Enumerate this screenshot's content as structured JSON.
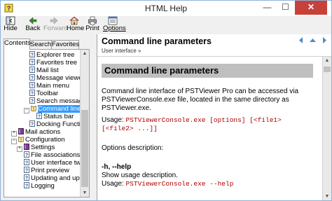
{
  "window": {
    "title": "HTML Help",
    "close_glyph": "✕",
    "min_glyph": "—",
    "max_glyph": "☐"
  },
  "toolbar": {
    "hide_label": "Hide",
    "back_label": "Back",
    "forward_label": "Forward",
    "home_label": "Home",
    "print_label": "Print",
    "options_label": "Options"
  },
  "left_tabs": {
    "contents": "Contents",
    "search": "Search",
    "favorites": "Favorites"
  },
  "tree": {
    "items": [
      {
        "label": "Explorer tree"
      },
      {
        "label": "Favorites tree"
      },
      {
        "label": "Mail list"
      },
      {
        "label": "Message viewer"
      },
      {
        "label": "Main menu"
      },
      {
        "label": "Toolbar"
      },
      {
        "label": "Search messages"
      },
      {
        "label": "Command line para"
      },
      {
        "label": "Status bar"
      },
      {
        "label": "Docking Functional"
      },
      {
        "label": "Mail actions"
      },
      {
        "label": "Configuration"
      },
      {
        "label": "Settings"
      },
      {
        "label": "File associations"
      },
      {
        "label": "User interface twe"
      },
      {
        "label": "Print preview"
      },
      {
        "label": "Updating and upda"
      },
      {
        "label": "Logging"
      }
    ]
  },
  "topic": {
    "title": "Command line parameters",
    "breadcrumb": "User interface »",
    "banner": "Command line parameters",
    "intro_line1": "Command line interface of PSTViewer Pro can be accessed via",
    "intro_line2": "PSTViewerConsole.exe file, located in the same directory as PSTViewer.exe.",
    "usage_prefix": "Usage: ",
    "usage_code1": "PSTViewerConsole.exe [options] [<file1>",
    "usage_code2": "[<file2> ...]]",
    "options_desc": "Options description:",
    "opt_h": "-h, --help",
    "opt_h_desc": "Show usage description.",
    "usage2_prefix": "Usage: ",
    "usage2_code": "PSTViewerConsole.exe --help"
  },
  "colors": {
    "selection": "#3399ff",
    "code": "#b00000",
    "banner": "#bfbfbf"
  }
}
